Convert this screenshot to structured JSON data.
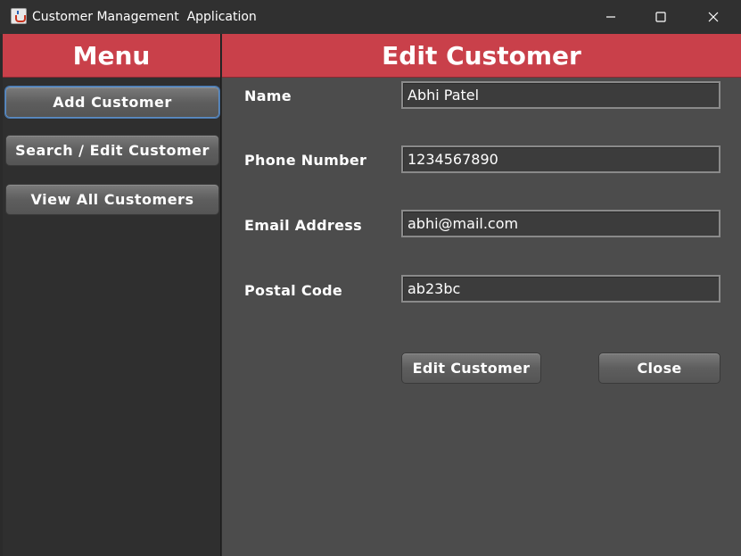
{
  "window": {
    "title": "Customer Management  Application"
  },
  "menu": {
    "header": "Menu",
    "items": [
      {
        "label": "Add Customer"
      },
      {
        "label": "Search / Edit Customer"
      },
      {
        "label": "View All Customers"
      }
    ]
  },
  "form": {
    "header": "Edit Customer",
    "fields": [
      {
        "label": "Name",
        "value": "Abhi Patel"
      },
      {
        "label": "Phone Number",
        "value": "1234567890"
      },
      {
        "label": "Email Address",
        "value": "abhi@mail.com"
      },
      {
        "label": "Postal Code",
        "value": "ab23bc"
      }
    ],
    "edit_button": "Edit Customer",
    "close_button": "Close"
  },
  "colors": {
    "header_accent": "#c9404a",
    "menu_bg": "#2f2f2f",
    "content_bg": "#4c4c4c",
    "titlebar_bg": "#303030"
  },
  "icons": {
    "app": "java-cup-icon",
    "minimize": "minimize-icon",
    "maximize": "maximize-icon",
    "close": "close-icon"
  }
}
